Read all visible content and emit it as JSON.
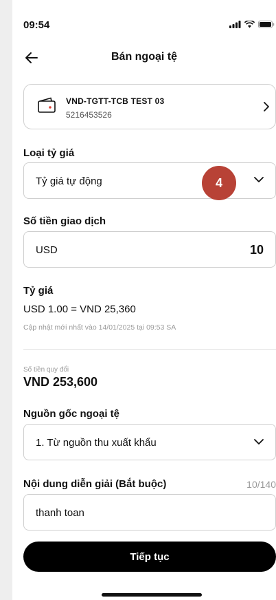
{
  "status_bar": {
    "time": "09:54"
  },
  "header": {
    "title": "Bán ngoại tệ"
  },
  "account": {
    "name": "VND-TGTT-TCB TEST 03",
    "number": "5216453526"
  },
  "rate_type": {
    "label": "Loại tỷ giá",
    "value": "Tỷ giá tự động"
  },
  "step_badge": "4",
  "transaction_amount": {
    "label": "Số tiền giao dịch",
    "currency": "USD",
    "amount": "10"
  },
  "exchange_rate": {
    "label": "Tỷ giá",
    "value": "USD 1.00 = VND 25,360",
    "updated": "Cập nhật mới nhất vào 14/01/2025 tại 09:53 SA"
  },
  "converted": {
    "label": "Số tiền quy đổi",
    "value": "VND 253,600"
  },
  "currency_source": {
    "label": "Nguồn gốc ngoại tệ",
    "value": "1. Từ nguồn thu xuất khẩu"
  },
  "description": {
    "label": "Nội dung diễn giải (Bắt buộc)",
    "counter": "10/140",
    "value": "thanh toan"
  },
  "continue_button": "Tiếp tục",
  "colors": {
    "badge": "#b84236",
    "button": "#000000",
    "wallet_dot": "#e0453a"
  }
}
